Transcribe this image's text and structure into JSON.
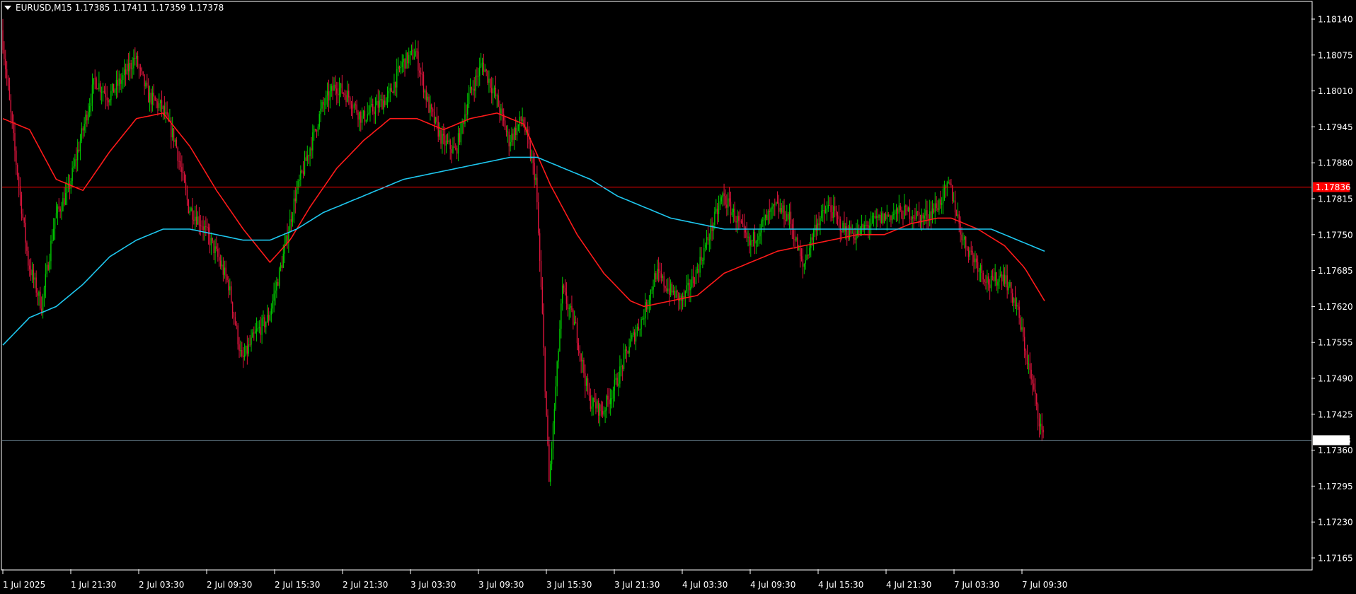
{
  "header": {
    "symbol": "EURUSD,M15",
    "open": "1.17385",
    "high": "1.17411",
    "low": "1.17359",
    "close": "1.17378"
  },
  "colors": {
    "background": "#000000",
    "bull_candle": "#00c800",
    "bear_candle": "#dc143c",
    "ma_fast": "#ff1a1a",
    "ma_slow": "#1ec8f0",
    "hline": "#ff0000",
    "bid_line": "#6e8796"
  },
  "chart_data": {
    "type": "candlestick",
    "symbol": "EURUSD",
    "timeframe": "M15",
    "price_axis": {
      "ticks": [
        "1.18140",
        "1.18075",
        "1.18010",
        "1.17945",
        "1.17880",
        "1.17815",
        "1.17750",
        "1.17685",
        "1.17620",
        "1.17555",
        "1.17490",
        "1.17425",
        "1.17360",
        "1.17295",
        "1.17230",
        "1.17165"
      ],
      "range": [
        1.1713,
        1.1817
      ]
    },
    "time_axis": {
      "labels": [
        "1 Jul 2025",
        "1 Jul 21:30",
        "2 Jul 03:30",
        "2 Jul 09:30",
        "2 Jul 15:30",
        "2 Jul 21:30",
        "3 Jul 03:30",
        "3 Jul 09:30",
        "3 Jul 15:30",
        "3 Jul 21:30",
        "4 Jul 03:30",
        "4 Jul 09:30",
        "4 Jul 15:30",
        "4 Jul 21:30",
        "7 Jul 03:30",
        "7 Jul 09:30"
      ]
    },
    "horizontal_line": {
      "price": 1.17836,
      "label": "1.17836"
    },
    "bid_line": {
      "price": 1.17378,
      "label": "1.17378"
    },
    "price_path": [
      [
        0,
        1.1812
      ],
      [
        10,
        1.179
      ],
      [
        20,
        1.177
      ],
      [
        30,
        1.1762
      ],
      [
        40,
        1.1778
      ],
      [
        50,
        1.1783
      ],
      [
        60,
        1.1793
      ],
      [
        70,
        1.1803
      ],
      [
        80,
        1.18
      ],
      [
        90,
        1.1803
      ],
      [
        100,
        1.1807
      ],
      [
        110,
        1.18
      ],
      [
        120,
        1.1798
      ],
      [
        130,
        1.1792
      ],
      [
        140,
        1.178
      ],
      [
        150,
        1.1777
      ],
      [
        160,
        1.1772
      ],
      [
        170,
        1.1766
      ],
      [
        180,
        1.1752
      ],
      [
        190,
        1.1757
      ],
      [
        200,
        1.176
      ],
      [
        210,
        1.177
      ],
      [
        220,
        1.1782
      ],
      [
        230,
        1.179
      ],
      [
        240,
        1.1798
      ],
      [
        250,
        1.1802
      ],
      [
        260,
        1.18
      ],
      [
        270,
        1.1796
      ],
      [
        280,
        1.1798
      ],
      [
        290,
        1.18
      ],
      [
        300,
        1.1806
      ],
      [
        310,
        1.1808
      ],
      [
        320,
        1.1798
      ],
      [
        330,
        1.1792
      ],
      [
        340,
        1.179
      ],
      [
        350,
        1.18
      ],
      [
        360,
        1.1806
      ],
      [
        370,
        1.18
      ],
      [
        380,
        1.1792
      ],
      [
        390,
        1.1796
      ],
      [
        400,
        1.1785
      ],
      [
        405,
        1.176
      ],
      [
        410,
        1.173
      ],
      [
        413,
        1.174
      ],
      [
        420,
        1.1765
      ],
      [
        430,
        1.1758
      ],
      [
        440,
        1.1745
      ],
      [
        450,
        1.1743
      ],
      [
        460,
        1.1748
      ],
      [
        470,
        1.1755
      ],
      [
        480,
        1.176
      ],
      [
        490,
        1.1768
      ],
      [
        500,
        1.1765
      ],
      [
        510,
        1.1763
      ],
      [
        520,
        1.1768
      ],
      [
        530,
        1.1775
      ],
      [
        540,
        1.1782
      ],
      [
        550,
        1.1778
      ],
      [
        560,
        1.1773
      ],
      [
        570,
        1.1777
      ],
      [
        580,
        1.178
      ],
      [
        590,
        1.1778
      ],
      [
        600,
        1.1769
      ],
      [
        610,
        1.1777
      ],
      [
        620,
        1.178
      ],
      [
        630,
        1.1776
      ],
      [
        640,
        1.1775
      ],
      [
        650,
        1.1777
      ],
      [
        660,
        1.1778
      ],
      [
        670,
        1.1779
      ],
      [
        680,
        1.1779
      ],
      [
        690,
        1.1778
      ],
      [
        700,
        1.178
      ],
      [
        710,
        1.1784
      ],
      [
        720,
        1.1774
      ],
      [
        730,
        1.177
      ],
      [
        740,
        1.1766
      ],
      [
        750,
        1.1768
      ],
      [
        760,
        1.1762
      ],
      [
        770,
        1.175
      ],
      [
        780,
        1.1738
      ]
    ],
    "series": [
      {
        "name": "MA fast",
        "role": "ma_fast",
        "values": [
          [
            0,
            1.1796
          ],
          [
            20,
            1.1794
          ],
          [
            40,
            1.1785
          ],
          [
            60,
            1.1783
          ],
          [
            80,
            1.179
          ],
          [
            100,
            1.1796
          ],
          [
            120,
            1.1797
          ],
          [
            140,
            1.1791
          ],
          [
            160,
            1.1783
          ],
          [
            180,
            1.1776
          ],
          [
            200,
            1.177
          ],
          [
            215,
            1.1774
          ],
          [
            230,
            1.178
          ],
          [
            250,
            1.1787
          ],
          [
            270,
            1.1792
          ],
          [
            290,
            1.1796
          ],
          [
            310,
            1.1796
          ],
          [
            330,
            1.1794
          ],
          [
            350,
            1.1796
          ],
          [
            370,
            1.1797
          ],
          [
            390,
            1.1795
          ],
          [
            410,
            1.1784
          ],
          [
            430,
            1.1775
          ],
          [
            450,
            1.1768
          ],
          [
            470,
            1.1763
          ],
          [
            480,
            1.1762
          ],
          [
            500,
            1.1763
          ],
          [
            520,
            1.1764
          ],
          [
            540,
            1.1768
          ],
          [
            560,
            1.177
          ],
          [
            580,
            1.1772
          ],
          [
            600,
            1.1773
          ],
          [
            620,
            1.1774
          ],
          [
            640,
            1.1775
          ],
          [
            660,
            1.1775
          ],
          [
            680,
            1.1777
          ],
          [
            700,
            1.1778
          ],
          [
            710,
            1.1778
          ],
          [
            730,
            1.1776
          ],
          [
            750,
            1.1773
          ],
          [
            765,
            1.1769
          ],
          [
            780,
            1.1763
          ]
        ]
      },
      {
        "name": "MA slow",
        "role": "ma_slow",
        "values": [
          [
            0,
            1.1755
          ],
          [
            20,
            1.176
          ],
          [
            40,
            1.1762
          ],
          [
            60,
            1.1766
          ],
          [
            80,
            1.1771
          ],
          [
            100,
            1.1774
          ],
          [
            120,
            1.1776
          ],
          [
            140,
            1.1776
          ],
          [
            160,
            1.1775
          ],
          [
            180,
            1.1774
          ],
          [
            200,
            1.1774
          ],
          [
            220,
            1.1776
          ],
          [
            240,
            1.1779
          ],
          [
            260,
            1.1781
          ],
          [
            280,
            1.1783
          ],
          [
            300,
            1.1785
          ],
          [
            320,
            1.1786
          ],
          [
            340,
            1.1787
          ],
          [
            360,
            1.1788
          ],
          [
            380,
            1.1789
          ],
          [
            400,
            1.1789
          ],
          [
            420,
            1.1787
          ],
          [
            440,
            1.1785
          ],
          [
            460,
            1.1782
          ],
          [
            480,
            1.178
          ],
          [
            500,
            1.1778
          ],
          [
            520,
            1.1777
          ],
          [
            540,
            1.1776
          ],
          [
            560,
            1.1776
          ],
          [
            580,
            1.1776
          ],
          [
            600,
            1.1776
          ],
          [
            620,
            1.1776
          ],
          [
            640,
            1.1776
          ],
          [
            660,
            1.1776
          ],
          [
            680,
            1.1776
          ],
          [
            700,
            1.1776
          ],
          [
            720,
            1.1776
          ],
          [
            740,
            1.1776
          ],
          [
            760,
            1.1774
          ],
          [
            780,
            1.1772
          ]
        ]
      }
    ],
    "grid": false,
    "candle_count": 780
  }
}
